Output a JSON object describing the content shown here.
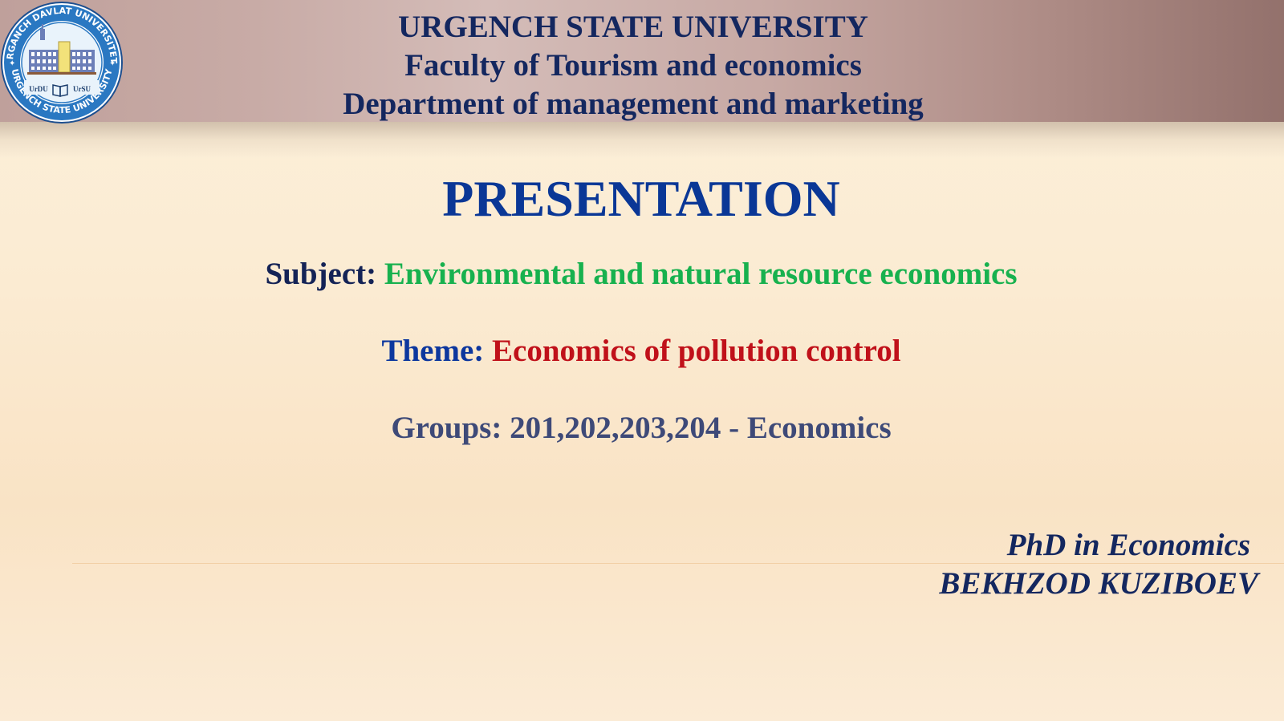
{
  "header": {
    "university": "URGENCH STATE UNIVERSITY",
    "faculty": "Faculty of Tourism and economics",
    "department": "Department of management and marketing"
  },
  "logo": {
    "outer_text_top": "URGANCH DAVLAT UNIVERSITETI",
    "outer_text_bottom": "URGENCH STATE UNIVERSITY",
    "badge_left": "UrDU",
    "badge_right": "UrSU",
    "colors": {
      "ring": "#2a78c2",
      "ring_dark": "#1d4f8f",
      "inner": "#e9f3fb",
      "building": "#6c7fb8",
      "gold": "#f2e27a"
    }
  },
  "title": "PRESENTATION",
  "subject": {
    "label": "Subject:",
    "value": "Environmental and natural resource economics"
  },
  "theme": {
    "label": "Theme:",
    "value": "Economics of pollution control"
  },
  "groups": "Groups: 201,202,203,204 - Economics",
  "author": {
    "degree": "PhD in Economics",
    "name": "BEKHZOD KUZIBOEV"
  },
  "colors": {
    "header_text": "#14275f",
    "title": "#0a3796",
    "subject_value": "#17b14e",
    "theme_label": "#0d379e",
    "theme_value": "#c0111a",
    "groups": "#3e4a78"
  }
}
